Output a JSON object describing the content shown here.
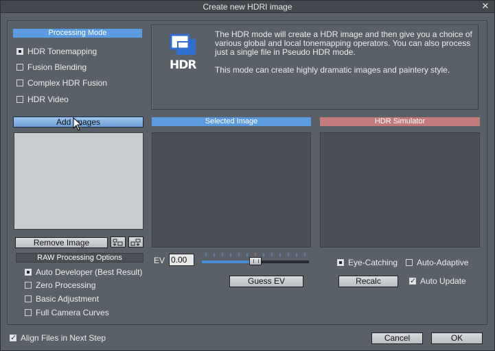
{
  "window": {
    "title": "Create new HDRI image",
    "close_glyph": "✕"
  },
  "processing_mode": {
    "header": "Processing  Mode",
    "options": [
      {
        "label": "HDR Tonemapping",
        "selected": true
      },
      {
        "label": "Fusion Blending",
        "selected": false
      },
      {
        "label": "Complex HDR Fusion",
        "selected": false
      },
      {
        "label": "HDR Video",
        "selected": false
      }
    ]
  },
  "info": {
    "logo_text": "HDR",
    "paragraph1": "The HDR mode will create a HDR image and then give you a choice of various global and local tonemapping operators. You can also process just a single file in Pseudo HDR mode.",
    "paragraph2": "This mode can create highly dramatic images and paintery style."
  },
  "images": {
    "add_button": "Add Images",
    "remove_button": "Remove Image",
    "sort_icon_1": "sort-ascending-icon",
    "sort_icon_2": "sort-descending-icon"
  },
  "raw_options": {
    "header": "RAW Processing Options",
    "options": [
      {
        "label": "Auto Developer (Best Result)",
        "selected": true
      },
      {
        "label": "Zero Processing",
        "selected": false
      },
      {
        "label": "Basic Adjustment",
        "selected": false
      },
      {
        "label": "Full Camera Curves",
        "selected": false
      }
    ]
  },
  "selected_image": {
    "header": "Selected Image"
  },
  "hdr_simulator": {
    "header": "HDR Simulator",
    "eye_catching": "Eye-Catching",
    "auto_adaptive": "Auto-Adaptive",
    "recalc_button": "Recalc",
    "auto_update": "Auto Update",
    "auto_update_checked": true
  },
  "ev": {
    "label": "EV",
    "value": "0.00",
    "guess_button": "Guess EV",
    "slider_fraction": 0.5
  },
  "footer": {
    "align_files": "Align Files in Next Step",
    "align_checked": true,
    "cancel_button": "Cancel",
    "ok_button": "OK"
  },
  "colors": {
    "accent_blue": "#5b9be0",
    "simulator_red": "#c27a7a",
    "panel_gray": "#5a6068"
  }
}
